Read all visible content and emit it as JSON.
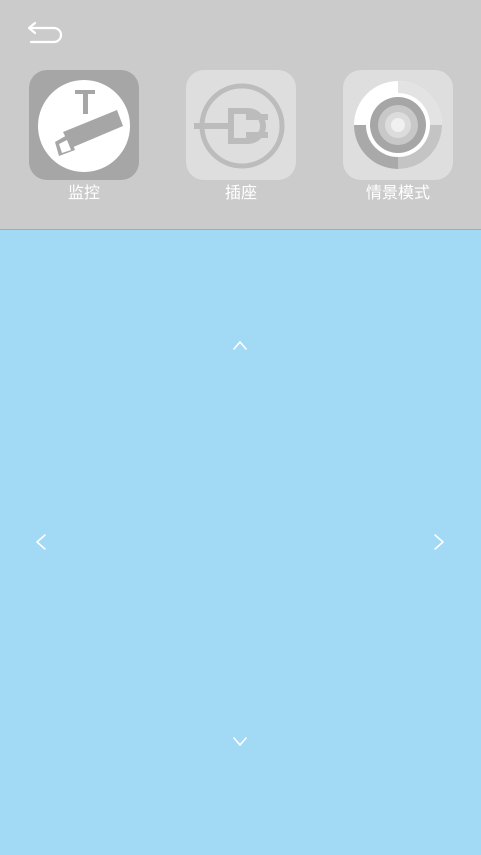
{
  "header": {
    "back_icon": "back-arrow-icon"
  },
  "tiles": [
    {
      "label": "监控",
      "icon": "camera-icon",
      "selected": true
    },
    {
      "label": "插座",
      "icon": "plug-icon",
      "selected": false
    },
    {
      "label": "情景模式",
      "icon": "scene-mode-icon",
      "selected": false
    }
  ],
  "control_pad": {
    "up_icon": "chevron-up-icon",
    "down_icon": "chevron-down-icon",
    "left_icon": "chevron-left-icon",
    "right_icon": "chevron-right-icon"
  },
  "colors": {
    "top_panel": "#cbcbcb",
    "control_pad": "#a2d9f5",
    "selected_tile": "#a6a6a6",
    "unselected_tile": "#dedede",
    "icon_white": "#ffffff"
  }
}
